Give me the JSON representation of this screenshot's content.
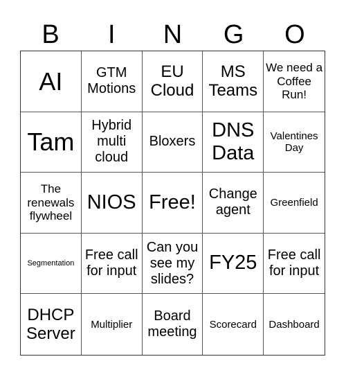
{
  "header": {
    "letters": [
      "B",
      "I",
      "N",
      "G",
      "O"
    ]
  },
  "cells": [
    {
      "text": "AI",
      "size": "s-xl"
    },
    {
      "text": "GTM Motions",
      "size": "s-m"
    },
    {
      "text": "EU Cloud",
      "size": "s-ml"
    },
    {
      "text": "MS Teams",
      "size": "s-ml"
    },
    {
      "text": "We need a Coffee Run!",
      "size": "s-sm"
    },
    {
      "text": "Tam",
      "size": "s-xl"
    },
    {
      "text": "Hybrid multi cloud",
      "size": "s-m"
    },
    {
      "text": "Bloxers",
      "size": "s-m"
    },
    {
      "text": "DNS Data",
      "size": "s-l"
    },
    {
      "text": "Valentines Day",
      "size": "s-s"
    },
    {
      "text": "The renewals flywheel",
      "size": "s-sm"
    },
    {
      "text": "NIOS",
      "size": "s-l"
    },
    {
      "text": "Free!",
      "size": "s-l"
    },
    {
      "text": "Change agent",
      "size": "s-m"
    },
    {
      "text": "Greenfield",
      "size": "s-s"
    },
    {
      "text": "Segmentation",
      "size": "s-xs"
    },
    {
      "text": "Free call for input",
      "size": "s-m"
    },
    {
      "text": "Can you see my slides?",
      "size": "s-m"
    },
    {
      "text": "FY25",
      "size": "s-l"
    },
    {
      "text": "Free call for input",
      "size": "s-m"
    },
    {
      "text": "DHCP Server",
      "size": "s-ml"
    },
    {
      "text": "Multiplier",
      "size": "s-s"
    },
    {
      "text": "Board meeting",
      "size": "s-m"
    },
    {
      "text": "Scorecard",
      "size": "s-s"
    },
    {
      "text": "Dashboard",
      "size": "s-s"
    }
  ]
}
